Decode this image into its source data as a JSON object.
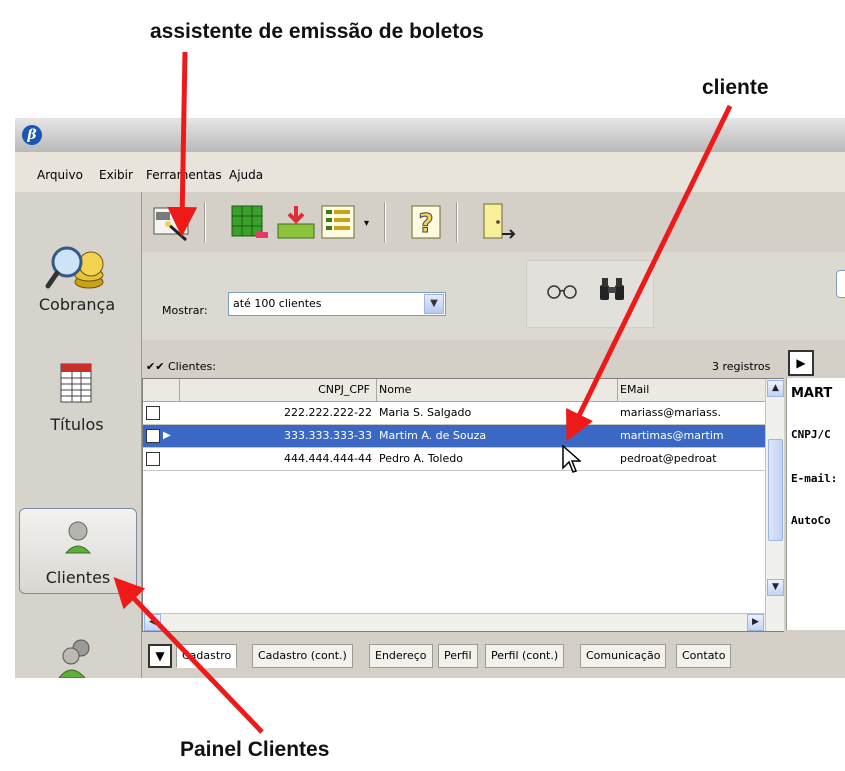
{
  "annotations": {
    "top": "assistente de emissão de boletos",
    "client": "cliente",
    "bottom": "Painel Clientes"
  },
  "menu": [
    "Arquivo",
    "Exibir",
    "Ferramentas",
    "Ajuda"
  ],
  "sidebar": {
    "items": [
      {
        "label": "Cobrança",
        "icon": "magnifier-coins-icon"
      },
      {
        "label": "Títulos",
        "icon": "spreadsheet-icon"
      },
      {
        "label": "Clientes",
        "icon": "person-icon",
        "active": true
      },
      {
        "label": "",
        "icon": "people-icon"
      }
    ]
  },
  "toolbar": {
    "icons": [
      "boleto-wizard-icon",
      "export-grid-icon",
      "download-tray-icon",
      "list-view-icon",
      "help-icon",
      "exit-door-icon"
    ]
  },
  "filter": {
    "label": "Mostrar:",
    "value": "até 100 clientes",
    "search_icons": [
      "glasses-icon",
      "binoculars-icon"
    ]
  },
  "list": {
    "title": "Clientes:",
    "count": "3 registros",
    "columns": [
      "CNPJ_CPF",
      "Nome",
      "EMail"
    ],
    "rows": [
      {
        "cnpj": "222.222.222-22",
        "nome": "Maria S. Salgado",
        "email": "mariass@mariass.",
        "selected": false
      },
      {
        "cnpj": "333.333.333-33",
        "nome": "Martim A. de Souza",
        "email": "martimas@martim",
        "selected": true
      },
      {
        "cnpj": "444.444.444-44",
        "nome": "Pedro A. Toledo",
        "email": "pedroat@pedroat",
        "selected": false
      }
    ]
  },
  "details": {
    "name": "MART",
    "fields": [
      "CNPJ/C",
      "E-mail:",
      "AutoCo"
    ]
  },
  "tabs": [
    "Cadastro",
    "Cadastro (cont.)",
    "Endereço",
    "Perfil",
    "Perfil (cont.)",
    "Comunicação",
    "Contato"
  ],
  "colors": {
    "selection": "#3b68c4",
    "arrow": "#ee1a1a"
  }
}
